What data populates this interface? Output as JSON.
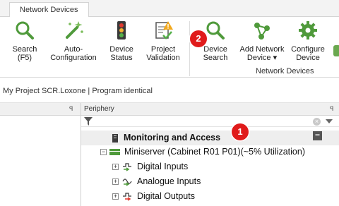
{
  "ribbon": {
    "tab_label": "Network Devices",
    "buttons": [
      {
        "id": "search",
        "label": "Search\n(F5)",
        "icon": "magnifier-icon"
      },
      {
        "id": "auto-config",
        "label": "Auto-\nConfiguration",
        "icon": "magic-wand-icon"
      },
      {
        "id": "device-status",
        "label": "Device\nStatus",
        "icon": "traffic-light-icon"
      },
      {
        "id": "project-validation",
        "label": "Project\nValidation",
        "icon": "clipboard-warning-icon"
      },
      {
        "id": "device-search",
        "label": "Device\nSearch",
        "icon": "magnifier-icon"
      },
      {
        "id": "add-network-device",
        "label": "Add Network\nDevice ▾",
        "icon": "network-nodes-icon"
      },
      {
        "id": "configure-device",
        "label": "Configure\nDevice",
        "icon": "gear-icon"
      }
    ],
    "group_label": "Network Devices"
  },
  "badges": {
    "one": "1",
    "two": "2"
  },
  "docbar": {
    "text": "My Project SCR.Loxone  |  Program identical"
  },
  "panes": {
    "right_title": "Periphery",
    "pin_glyph": "ꟼ"
  },
  "tree": [
    {
      "label": "Monitoring and Access",
      "icon": "device-box-icon",
      "bold": true
    },
    {
      "label": "Miniserver (Cabinet R01 P01)(~5% Utilization)",
      "icon": "miniserver-icon",
      "bold": false
    },
    {
      "label": "Digital Inputs",
      "icon": "digital-input-icon",
      "bold": false
    },
    {
      "label": "Analogue Inputs",
      "icon": "analogue-input-icon",
      "bold": false
    },
    {
      "label": "Digital Outputs",
      "icon": "digital-output-icon",
      "bold": false
    }
  ],
  "colors": {
    "accent_green": "#4f9a3b",
    "badge_red": "#e01b1b"
  }
}
